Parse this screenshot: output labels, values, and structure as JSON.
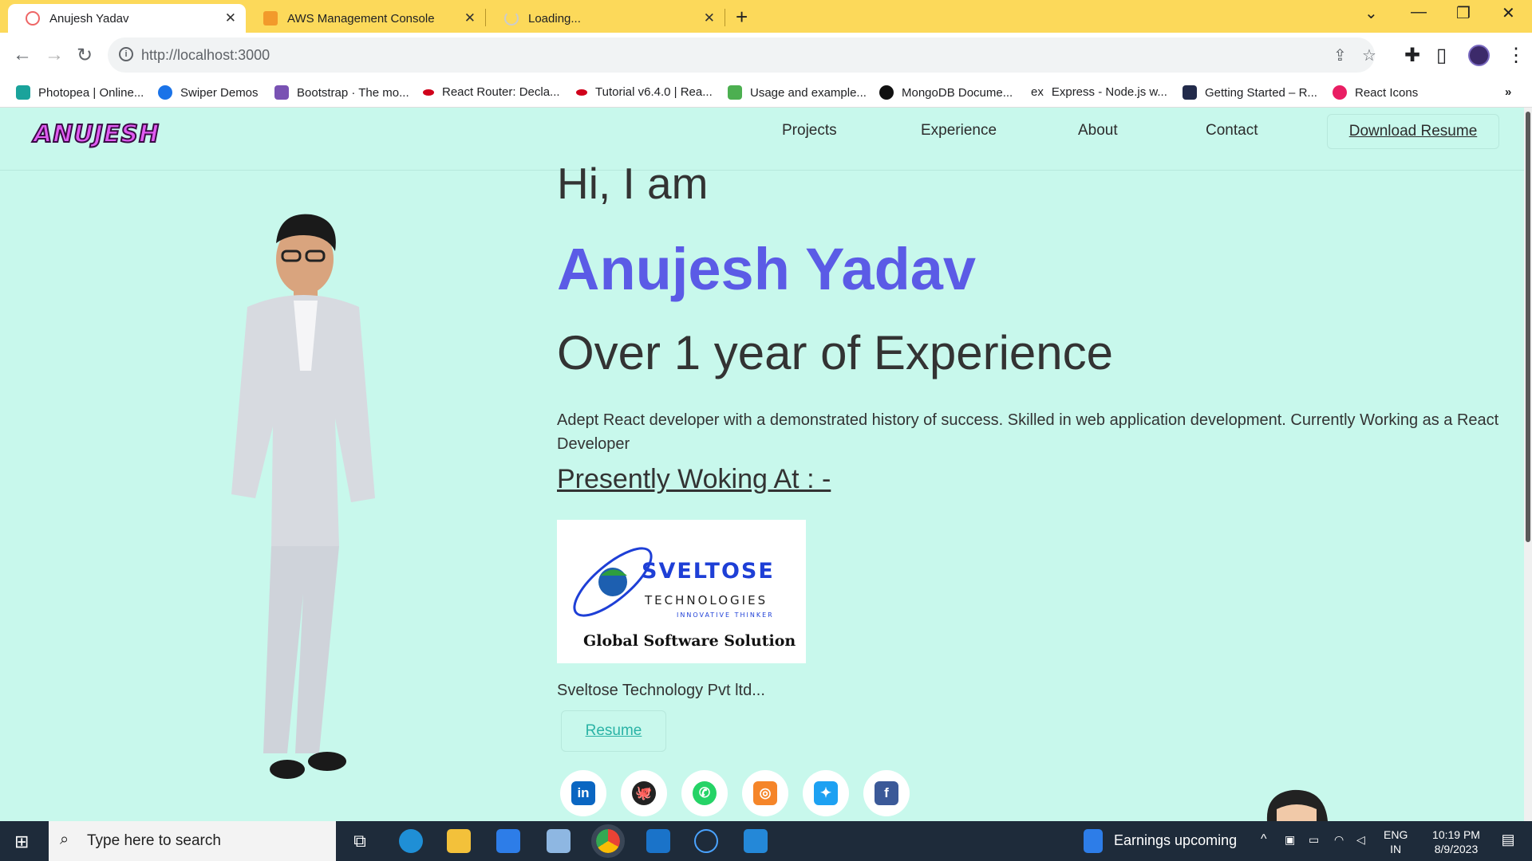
{
  "browser": {
    "tabs": [
      {
        "title": "Anujesh Yadav",
        "active": true
      },
      {
        "title": "AWS Management Console",
        "active": false
      },
      {
        "title": "Loading...",
        "active": false
      }
    ],
    "url": "http://localhost:3000",
    "bookmarks": [
      "Photopea | Online...",
      "Swiper Demos",
      "Bootstrap · The mo...",
      "React Router: Decla...",
      "Tutorial v6.4.0 | Rea...",
      "Usage and example...",
      "MongoDB Docume...",
      "Express - Node.js w...",
      "Getting Started – R...",
      "React Icons"
    ],
    "bookmark_overflow": "»",
    "icons": [
      "back-icon",
      "forward-icon",
      "reload-icon",
      "info-icon",
      "share-icon",
      "star-icon",
      "extensions-icon",
      "sidepanel-icon",
      "profile-avatar",
      "menu-icon"
    ]
  },
  "site": {
    "logo": "ANUJESH",
    "nav": [
      "Projects",
      "Experience",
      "About",
      "Contact"
    ],
    "download_resume": "Download Resume",
    "greeting": "Hi, I am",
    "name": "Anujesh Yadav",
    "experience": "Over 1 year of Experience",
    "description": "Adept React developer with a demonstrated history of success. Skilled in web application development. Currently Working as a React Developer",
    "presently": "Presently Woking At : -",
    "company_logo": {
      "brand": "SVELTOSE",
      "sub": "TECHNOLOGIES",
      "tagline": "INNOVATIVE THINKER",
      "footer": "Global Software Solution"
    },
    "company": "Sveltose Technology Pvt ltd...",
    "resume": "Resume",
    "social": [
      {
        "name": "linkedin",
        "glyph": "in",
        "color": "#0a66c2"
      },
      {
        "name": "github",
        "glyph": "⬤",
        "color": "#222222"
      },
      {
        "name": "whatsapp",
        "glyph": "✆",
        "color": "#25d366"
      },
      {
        "name": "instagram",
        "glyph": "◎",
        "color": "#f58529"
      },
      {
        "name": "twitter",
        "glyph": "🐦",
        "color": "#1da1f2"
      },
      {
        "name": "facebook",
        "glyph": "f",
        "color": "#3b5998"
      }
    ],
    "accent": "#5b5be6",
    "background": "#c8f8ec"
  },
  "taskbar": {
    "search_placeholder": "Type here to search",
    "news": "Earnings upcoming",
    "lang": "ENG",
    "region": "IN",
    "time": "10:19 PM",
    "date": "8/9/2023"
  }
}
